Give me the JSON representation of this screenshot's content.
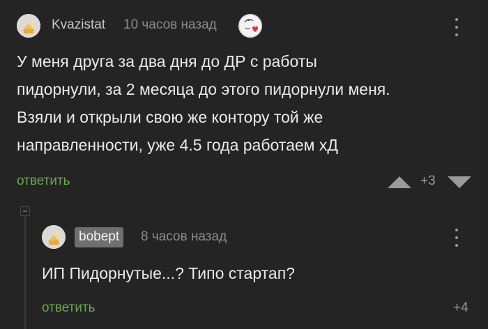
{
  "comment1": {
    "username": "Kvazistat",
    "timestamp": "10 часов назад",
    "badge_icon": "heart-sticker-icon",
    "text": "У меня друга за два дня до ДР с работы\nпидорнули, за 2 месяца до этого пидорнули меня.\nВзяли и открыли свою же контору той же\nнаправленности, уже 4.5 года работаем хД",
    "reply_label": "ответить",
    "rating": "+3"
  },
  "comment2": {
    "username": "bobept",
    "timestamp": "8 часов назад",
    "text": "ИП Пидорнутые...? Типо стартап?",
    "reply_label": "ответить",
    "rating": "+4"
  },
  "colors": {
    "background": "#242424",
    "reply_link": "#6aa84f",
    "username_pill": "#6f6f6f"
  }
}
